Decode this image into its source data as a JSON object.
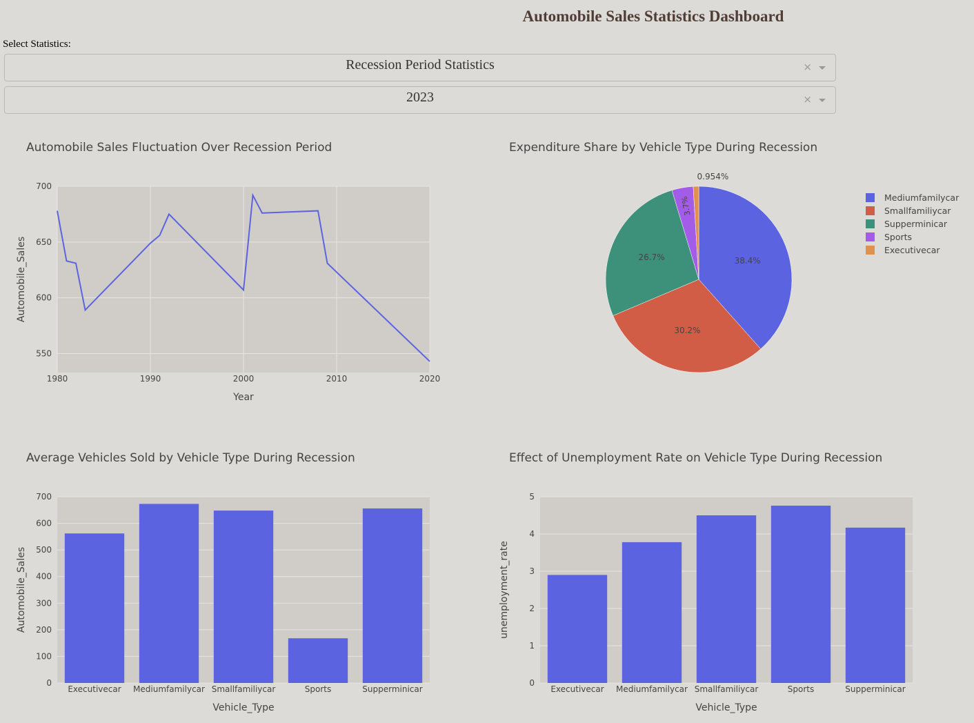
{
  "header": {
    "title": "Automobile Sales Statistics Dashboard"
  },
  "controls": {
    "select_label": "Select Statistics:",
    "statistics_dropdown": {
      "value": "Recession Period Statistics",
      "clear_icon": "×"
    },
    "year_dropdown": {
      "value": "2023",
      "clear_icon": "×"
    }
  },
  "colors": {
    "line": "#5b63e0",
    "bar": "#5b63e0",
    "plot_bg": "#d0cdc9",
    "pie": [
      "#5b63e0",
      "#d25d47",
      "#3d917a",
      "#a25ce8",
      "#e0914e"
    ]
  },
  "chart_data": [
    {
      "type": "line",
      "title": "Automobile Sales Fluctuation Over Recession Period",
      "xlabel": "Year",
      "ylabel": "Automobile_Sales",
      "xlim": [
        1980,
        2020
      ],
      "ylim": [
        533,
        700
      ],
      "xticks": [
        1980,
        1990,
        2000,
        2010,
        2020
      ],
      "yticks": [
        550,
        600,
        650,
        700
      ],
      "grid": true,
      "x": [
        1980,
        1981,
        1982,
        1983,
        1990,
        1991,
        1992,
        2000,
        2001,
        2002,
        2008,
        2009,
        2020
      ],
      "y": [
        678,
        633,
        631,
        589,
        649,
        656,
        675,
        607,
        692,
        676,
        678,
        631,
        543
      ]
    },
    {
      "type": "pie",
      "title": "Expenditure Share by Vehicle Type During Recession",
      "legend_position": "right",
      "labels": [
        "Mediumfamilycar",
        "Smallfamiliycar",
        "Supperminicar",
        "Sports",
        "Executivecar"
      ],
      "values": [
        38.4,
        30.2,
        26.7,
        3.7,
        0.954
      ],
      "value_labels": [
        "38.4%",
        "30.2%",
        "26.7%",
        "3.7%",
        "0.954%"
      ]
    },
    {
      "type": "bar",
      "title": "Average Vehicles Sold by Vehicle Type During Recession",
      "xlabel": "Vehicle_Type",
      "ylabel": "Automobile_Sales",
      "ylim": [
        0,
        700
      ],
      "yticks": [
        0,
        100,
        200,
        300,
        400,
        500,
        600,
        700
      ],
      "categories": [
        "Executivecar",
        "Mediumfamilycar",
        "Smallfamiliycar",
        "Sports",
        "Supperminicar"
      ],
      "values": [
        562,
        673,
        648,
        168,
        656
      ]
    },
    {
      "type": "bar",
      "title": "Effect of Unemployment Rate on Vehicle Type During Recession",
      "xlabel": "Vehicle_Type",
      "ylabel": "unemployment_rate",
      "ylim": [
        0,
        5
      ],
      "yticks": [
        0,
        1,
        2,
        3,
        4,
        5
      ],
      "categories": [
        "Executivecar",
        "Mediumfamilycar",
        "Smallfamiliycar",
        "Sports",
        "Supperminicar"
      ],
      "values": [
        2.9,
        3.78,
        4.5,
        4.76,
        4.17
      ]
    }
  ]
}
